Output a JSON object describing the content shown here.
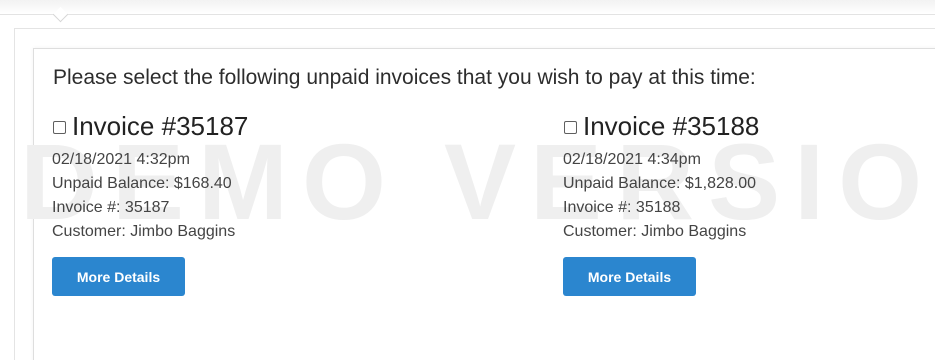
{
  "watermark": "DEMO VERSION",
  "prompt": "Please select the following unpaid invoices that you wish to pay at this time:",
  "invoices": [
    {
      "title": "Invoice #35187",
      "datetime": "02/18/2021 4:32pm",
      "balance": "Unpaid Balance: $168.40",
      "number": "Invoice #: 35187",
      "customer": "Customer: Jimbo Baggins",
      "button_label": "More Details",
      "checked": false
    },
    {
      "title": "Invoice #35188",
      "datetime": "02/18/2021 4:34pm",
      "balance": "Unpaid Balance: $1,828.00",
      "number": "Invoice #: 35188",
      "customer": "Customer: Jimbo Baggins",
      "button_label": "More Details",
      "checked": false
    }
  ],
  "colors": {
    "button": "#2b86cf",
    "watermark": "#efefef",
    "text": "#333333"
  }
}
